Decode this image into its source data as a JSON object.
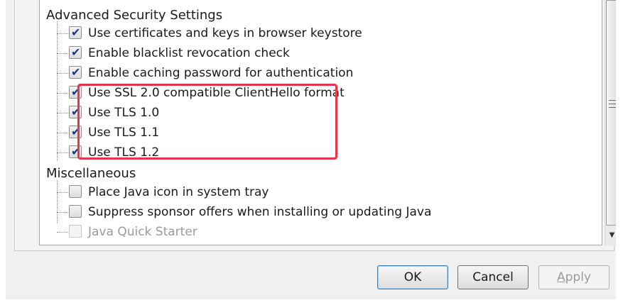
{
  "tree": {
    "sections": [
      {
        "heading": "Advanced Security Settings",
        "items": [
          {
            "label": "Use certificates and keys in browser keystore",
            "checked": true,
            "disabled": false
          },
          {
            "label": "Enable blacklist revocation check",
            "checked": true,
            "disabled": false
          },
          {
            "label": "Enable caching password for authentication",
            "checked": true,
            "disabled": false
          },
          {
            "label": "Use SSL 2.0 compatible ClientHello format",
            "checked": true,
            "disabled": false
          },
          {
            "label": "Use TLS 1.0",
            "checked": true,
            "disabled": false
          },
          {
            "label": "Use TLS 1.1",
            "checked": true,
            "disabled": false
          },
          {
            "label": "Use TLS 1.2",
            "checked": true,
            "disabled": false
          }
        ]
      },
      {
        "heading": "Miscellaneous",
        "items": [
          {
            "label": "Place Java icon in system tray",
            "checked": false,
            "disabled": false
          },
          {
            "label": "Suppress sponsor offers when installing or updating Java",
            "checked": false,
            "disabled": false
          },
          {
            "label": "Java Quick Starter",
            "checked": false,
            "disabled": true
          }
        ]
      }
    ]
  },
  "highlight": {
    "color": "#e8344c"
  },
  "buttons": {
    "ok": "OK",
    "cancel": "Cancel",
    "apply_first": "A",
    "apply_rest": "pply"
  }
}
